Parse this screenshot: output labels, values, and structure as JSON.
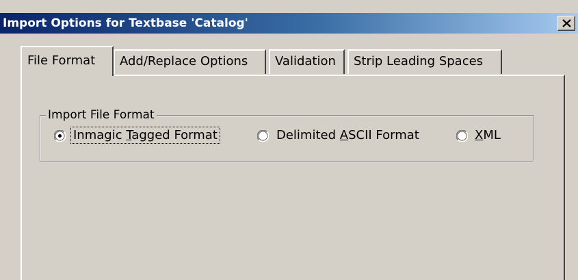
{
  "window": {
    "title": "Import Options for Textbase 'Catalog'",
    "close_glyph": "×",
    "title_gradient": [
      "#0a246a",
      "#a6caf0"
    ]
  },
  "tabs": [
    {
      "label": "File Format",
      "active": true
    },
    {
      "label": "Add/Replace Options",
      "active": false
    },
    {
      "label": "Validation",
      "active": false
    },
    {
      "label": "Strip Leading Spaces",
      "active": false
    }
  ],
  "import_format": {
    "group_label": "Import File Format",
    "options": [
      {
        "label_pre": "Inmagic ",
        "mnemonic": "T",
        "label_post": "agged Format",
        "selected": true
      },
      {
        "label_pre": "Delimited ",
        "mnemonic": "A",
        "label_post": "SCII Format",
        "selected": false
      },
      {
        "label_pre": "",
        "mnemonic": "X",
        "label_post": "ML",
        "selected": false
      }
    ]
  }
}
